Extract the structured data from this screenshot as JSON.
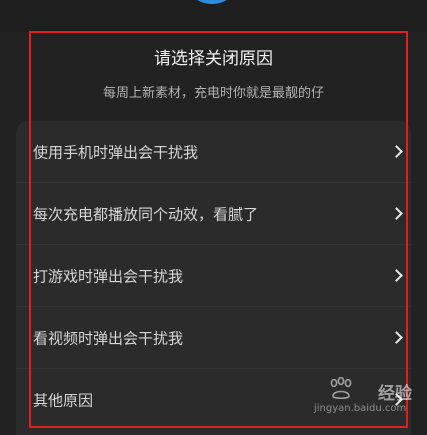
{
  "dialog": {
    "title": "请选择关闭原因",
    "subtitle": "每周上新素材，充电时你就是最靓的仔"
  },
  "reasons": [
    {
      "label": "使用手机时弹出会干扰我"
    },
    {
      "label": "每次充电都播放同个动效，看腻了"
    },
    {
      "label": "打游戏时弹出会干扰我"
    },
    {
      "label": "看视频时弹出会干扰我"
    },
    {
      "label": "其他原因"
    }
  ],
  "watermark": {
    "brand": "经验",
    "url": "jingyan.baidu.com"
  },
  "colors": {
    "background": "#1e1e1e",
    "list_background": "#2b2b2b",
    "highlight_border": "#e02020",
    "top_accent": "#2a8de0"
  }
}
